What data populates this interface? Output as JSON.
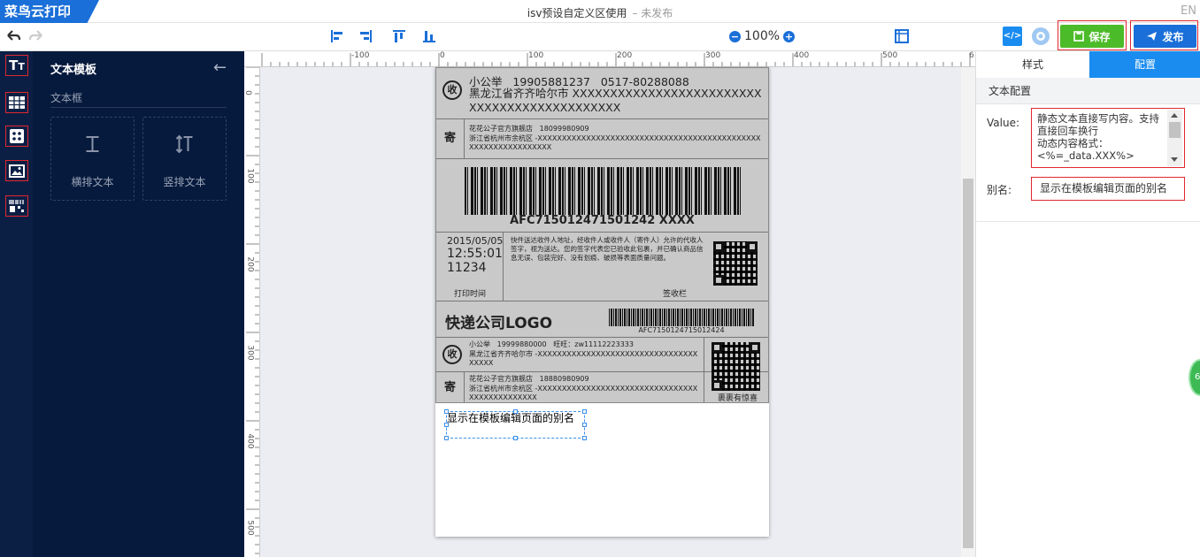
{
  "app": {
    "logo": "菜鸟云打印",
    "title": "isv预设自定义区使用",
    "status": "– 未发布",
    "lang": "EN"
  },
  "toolbar": {
    "zoom": "100%",
    "save_label": "保存",
    "publish_label": "发布"
  },
  "panel": {
    "title": "文本模板",
    "subtitle": "文本框",
    "cards": [
      {
        "label": "横排文本"
      },
      {
        "label": "竖排文本"
      }
    ]
  },
  "ruler": {
    "top": [
      "-100",
      "0",
      "100",
      "200",
      "300",
      "400",
      "500",
      "6"
    ],
    "left": [
      "0",
      "100",
      "200",
      "300",
      "400",
      "500"
    ]
  },
  "label": {
    "recv_icon": "收",
    "recv_name_line": "小公举   19905881237   0517-80288088",
    "recv_addr": "黑龙江省齐齐哈尔市 XXXXXXXXXXXXXXXXXXXXXXXXXXXXXXXXXXXXXXXXXXXXX",
    "send_icon": "寄",
    "send_name_line": "花花公子官方旗舰店   18099980909",
    "send_addr": "浙江省杭州市余杭区 -XXXXXXXXXXXXXXXXXXXXXXXXXXXXXXXXXXXXXXXXXXXXXXXXXXXXXXXXXXXXXXX",
    "barcode_text": "AFC715012471501242 XXXX",
    "date": "2015/05/05",
    "time": "12:55:01",
    "num": "11234",
    "notice": "快件送达收件人地址，经收件人或收件人（寄件人）允许的代收人签字，视为送达。您的签字代表您已验收此包裹，并已确认商品信息无误、包装完好、没有划痕、破损等表面质量问题。",
    "print_time": "打印时间",
    "sign_label": "签收栏",
    "company_logo": "快递公司LOGO",
    "barcode2_text": "AFC7150124715012424",
    "recv2_name": "小公举   19999880000   旺旺：zw11112223333",
    "recv2_addr": "黑龙江省齐齐哈尔市 -XXXXXXXXXXXXXXXXXXXXXXXXXXXXXXXXXXXXXX",
    "send2_name": "花花公子官方旗舰店   18880980909",
    "send2_addr": "浙江省杭州市余杭区 -XXXXXXXXXXXXXXXXXXXXXXXXXXXXXXXXXXXXXXXXXXXXXXX",
    "qr_caption": "裹裹有惊喜"
  },
  "selection": {
    "text": "显示在模板编辑页面的别名"
  },
  "right": {
    "tab_style": "样式",
    "tab_config": "配置",
    "section": "文本配置",
    "value_label": "Value:",
    "value_text": "静态文本直接写内容。支持直接回车换行\n动态内容格式：\n<%=_data.XXX%>",
    "alias_label": "别名:",
    "alias_value": "显示在模板编辑页面的别名"
  },
  "badge": "6"
}
